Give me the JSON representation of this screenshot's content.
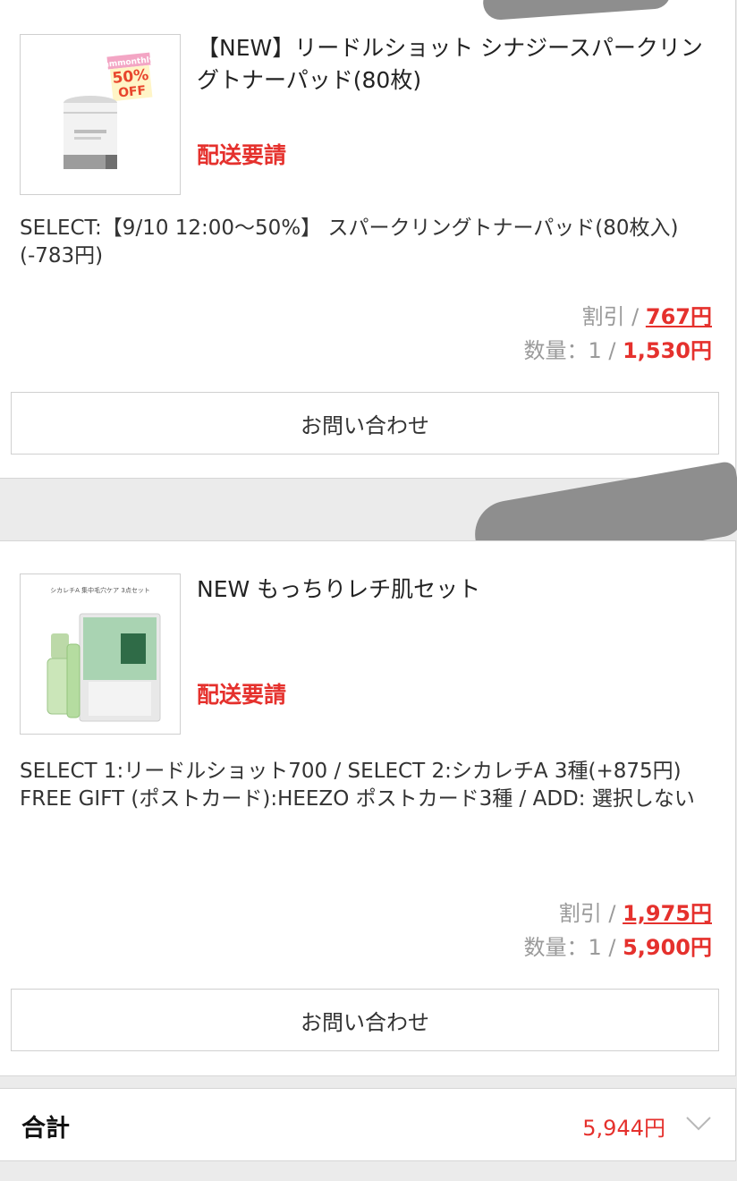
{
  "items": [
    {
      "title": "【NEW】リードルショット シナジースパークリングトナーパッド(80枚)",
      "status": "配送要請",
      "option": "SELECT:【9/10 12:00〜50%】 スパークリングトナーパッド(80枚入)(-783円)",
      "discount_label": "割引 / ",
      "discount": "767円",
      "quantity_label": "数量：1 / ",
      "price": "1,530円",
      "inquiry_label": "お問い合わせ",
      "badge_top": "ammonthly",
      "badge_pct": "50%",
      "badge_off": "OFF"
    },
    {
      "title": "NEW もっちりレチ肌セット",
      "status": "配送要請",
      "option_line1": "SELECT 1:リードルショット700 / SELECT 2:シカレチA 3種(+875円)",
      "option_line2": "FREE GIFT (ポストカード):HEEZO ポストカード3種 / ADD: 選択しない",
      "discount_label": "割引 / ",
      "discount": "1,975円",
      "quantity_label": "数量：1 / ",
      "price": "5,900円",
      "inquiry_label": "お問い合わせ",
      "thumb_caption": "シカレチA 集中毛穴ケア 3点セット"
    }
  ],
  "total": {
    "label": "合計",
    "value": "5,944円",
    "icon": "chevron-down-icon"
  },
  "colors": {
    "accent": "#e5312d",
    "muted": "#9a9a9a",
    "background": "#ebebeb"
  }
}
